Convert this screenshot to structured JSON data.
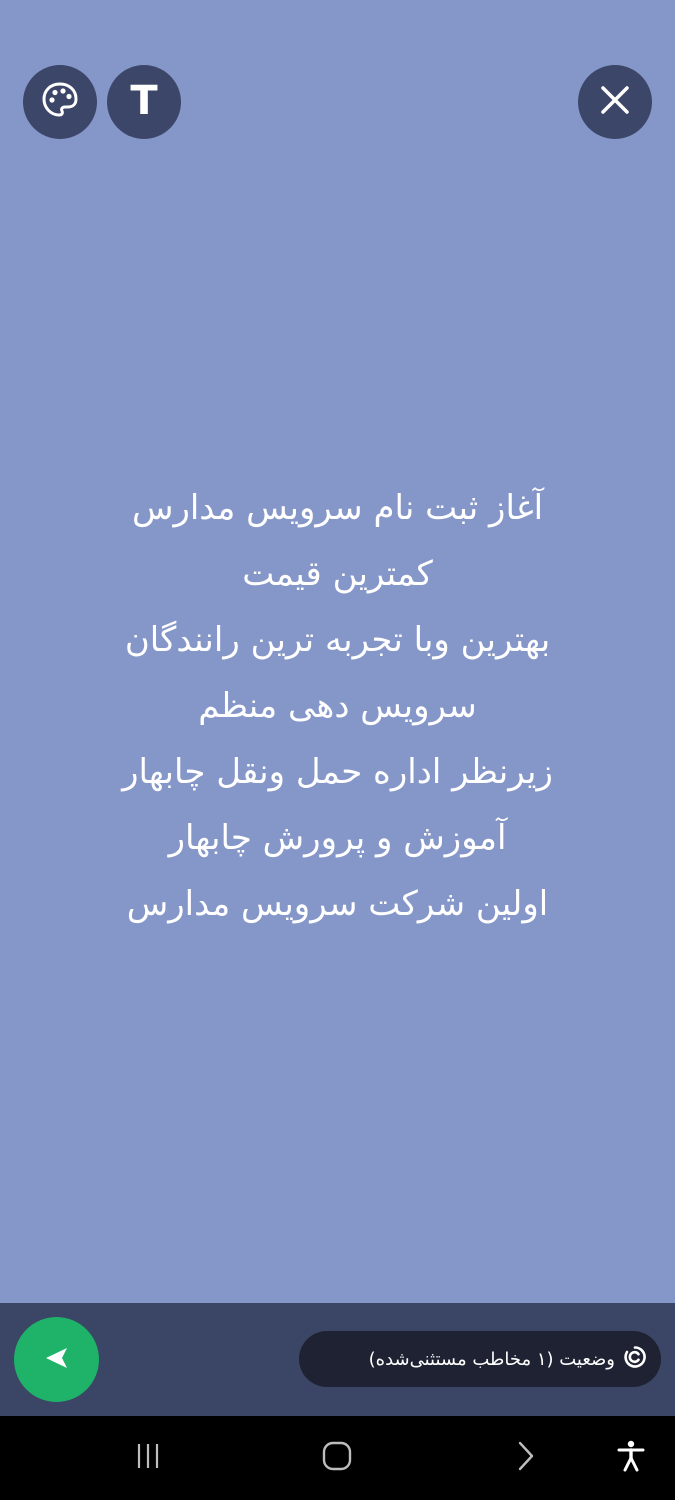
{
  "toolbar": {
    "palette_icon": "palette-icon",
    "text_button_label": "T",
    "close_icon": "close-icon"
  },
  "status": {
    "lines": [
      "آغاز ثبت نام سرویس مدارس",
      "کمترین قیمت",
      "بهترین وبا تجربه ترین رانندگان",
      "سرویس دهی منظم",
      "زیرنظر اداره حمل ونقل چابهار",
      "آموزش و پرورش چابهار",
      "اولین شرکت سرویس مدارس"
    ],
    "background_color": "#8596c8",
    "text_color": "#ffffff"
  },
  "composer": {
    "privacy_label": "وضعیت (۱ مخاطب مستثنی‌شده)",
    "privacy_icon": "status-ring-icon",
    "send_icon": "send-icon",
    "send_color": "#1fb36a"
  },
  "navbar": {
    "recent_icon": "recent-apps-icon",
    "home_icon": "home-icon",
    "back_icon": "back-icon",
    "accessibility_icon": "accessibility-icon"
  }
}
